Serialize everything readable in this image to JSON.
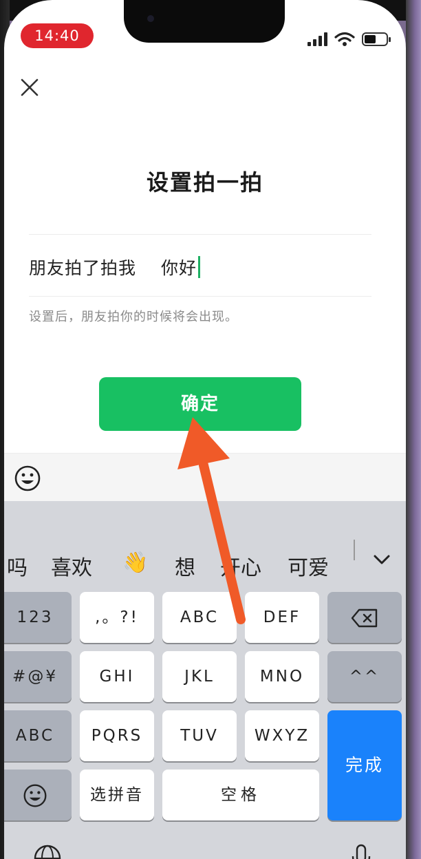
{
  "status_bar": {
    "time": "14:40"
  },
  "dialog": {
    "title": "设置拍一拍",
    "pat_label": "朋友拍了拍我",
    "pat_value": "你好",
    "hint": "设置后，朋友拍你的时候将会出现。",
    "confirm_label": "确定"
  },
  "keyboard": {
    "candidates": [
      "吗",
      "喜欢",
      "👋",
      "想",
      "开心",
      "可爱"
    ],
    "rows": {
      "row1": [
        "123",
        ",。?!",
        "ABC",
        "DEF"
      ],
      "row2": [
        "#@¥",
        "GHI",
        "JKL",
        "MNO",
        "^^"
      ],
      "row3": [
        "ABC",
        "PQRS",
        "TUV",
        "WXYZ"
      ],
      "row4": [
        "选拼音",
        "空格"
      ]
    },
    "done_label": "完成"
  },
  "colors": {
    "accent_green": "#18c062",
    "keyboard_blue": "#1a82fb",
    "status_red": "#e0262e",
    "annotation_arrow": "#f05a28"
  },
  "icons": {
    "close": "close-icon",
    "emoji": "emoji-icon",
    "backspace": "backspace-icon",
    "collapse": "chevron-down-icon",
    "globe": "globe-icon",
    "microphone": "microphone-icon"
  }
}
